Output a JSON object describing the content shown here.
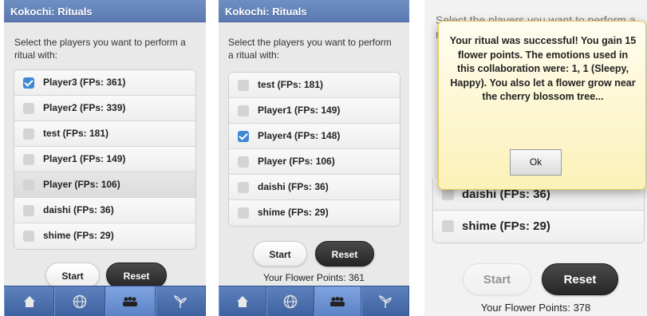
{
  "app_title": "Kokochi: Rituals",
  "prompt": "Select the players you want to perform a ritual with:",
  "start_label": "Start",
  "reset_label": "Reset",
  "accent_color": "#3f88d6",
  "header_color": "#6586bb",
  "nav_icons": [
    "home-icon",
    "globe-icon",
    "group-icon",
    "flower-icon"
  ],
  "screen1": {
    "players": [
      {
        "label": "Player3 (FPs: 361)",
        "checked": true
      },
      {
        "label": "Player2 (FPs: 339)",
        "checked": false
      },
      {
        "label": "test (FPs: 181)",
        "checked": false
      },
      {
        "label": "Player1 (FPs: 149)",
        "checked": false
      },
      {
        "label": "Player (FPs: 106)",
        "checked": false
      },
      {
        "label": "daishi (FPs: 36)",
        "checked": false
      },
      {
        "label": "shime (FPs: 29)",
        "checked": false
      }
    ],
    "active_tab": 2
  },
  "screen2": {
    "players": [
      {
        "label": "test (FPs: 181)",
        "checked": false
      },
      {
        "label": "Player1 (FPs: 149)",
        "checked": false
      },
      {
        "label": "Player4 (FPs: 148)",
        "checked": true
      },
      {
        "label": "Player (FPs: 106)",
        "checked": false
      },
      {
        "label": "daishi (FPs: 36)",
        "checked": false
      },
      {
        "label": "shime (FPs: 29)",
        "checked": false
      }
    ],
    "flower_points": "Your Flower Points: 361",
    "active_tab": 2
  },
  "screen3": {
    "players": [
      {
        "label": "daishi (FPs: 36)",
        "checked": false
      },
      {
        "label": "shime (FPs: 29)",
        "checked": false
      }
    ],
    "flower_points": "Your Flower Points: 378",
    "dialog": {
      "message": "Your ritual was successful! You gain 15 flower points. The emotions used in this collaboration were: 1, 1 (Sleepy, Happy). You also let a flower grow near the cherry blossom tree...",
      "ok_label": "Ok"
    }
  }
}
